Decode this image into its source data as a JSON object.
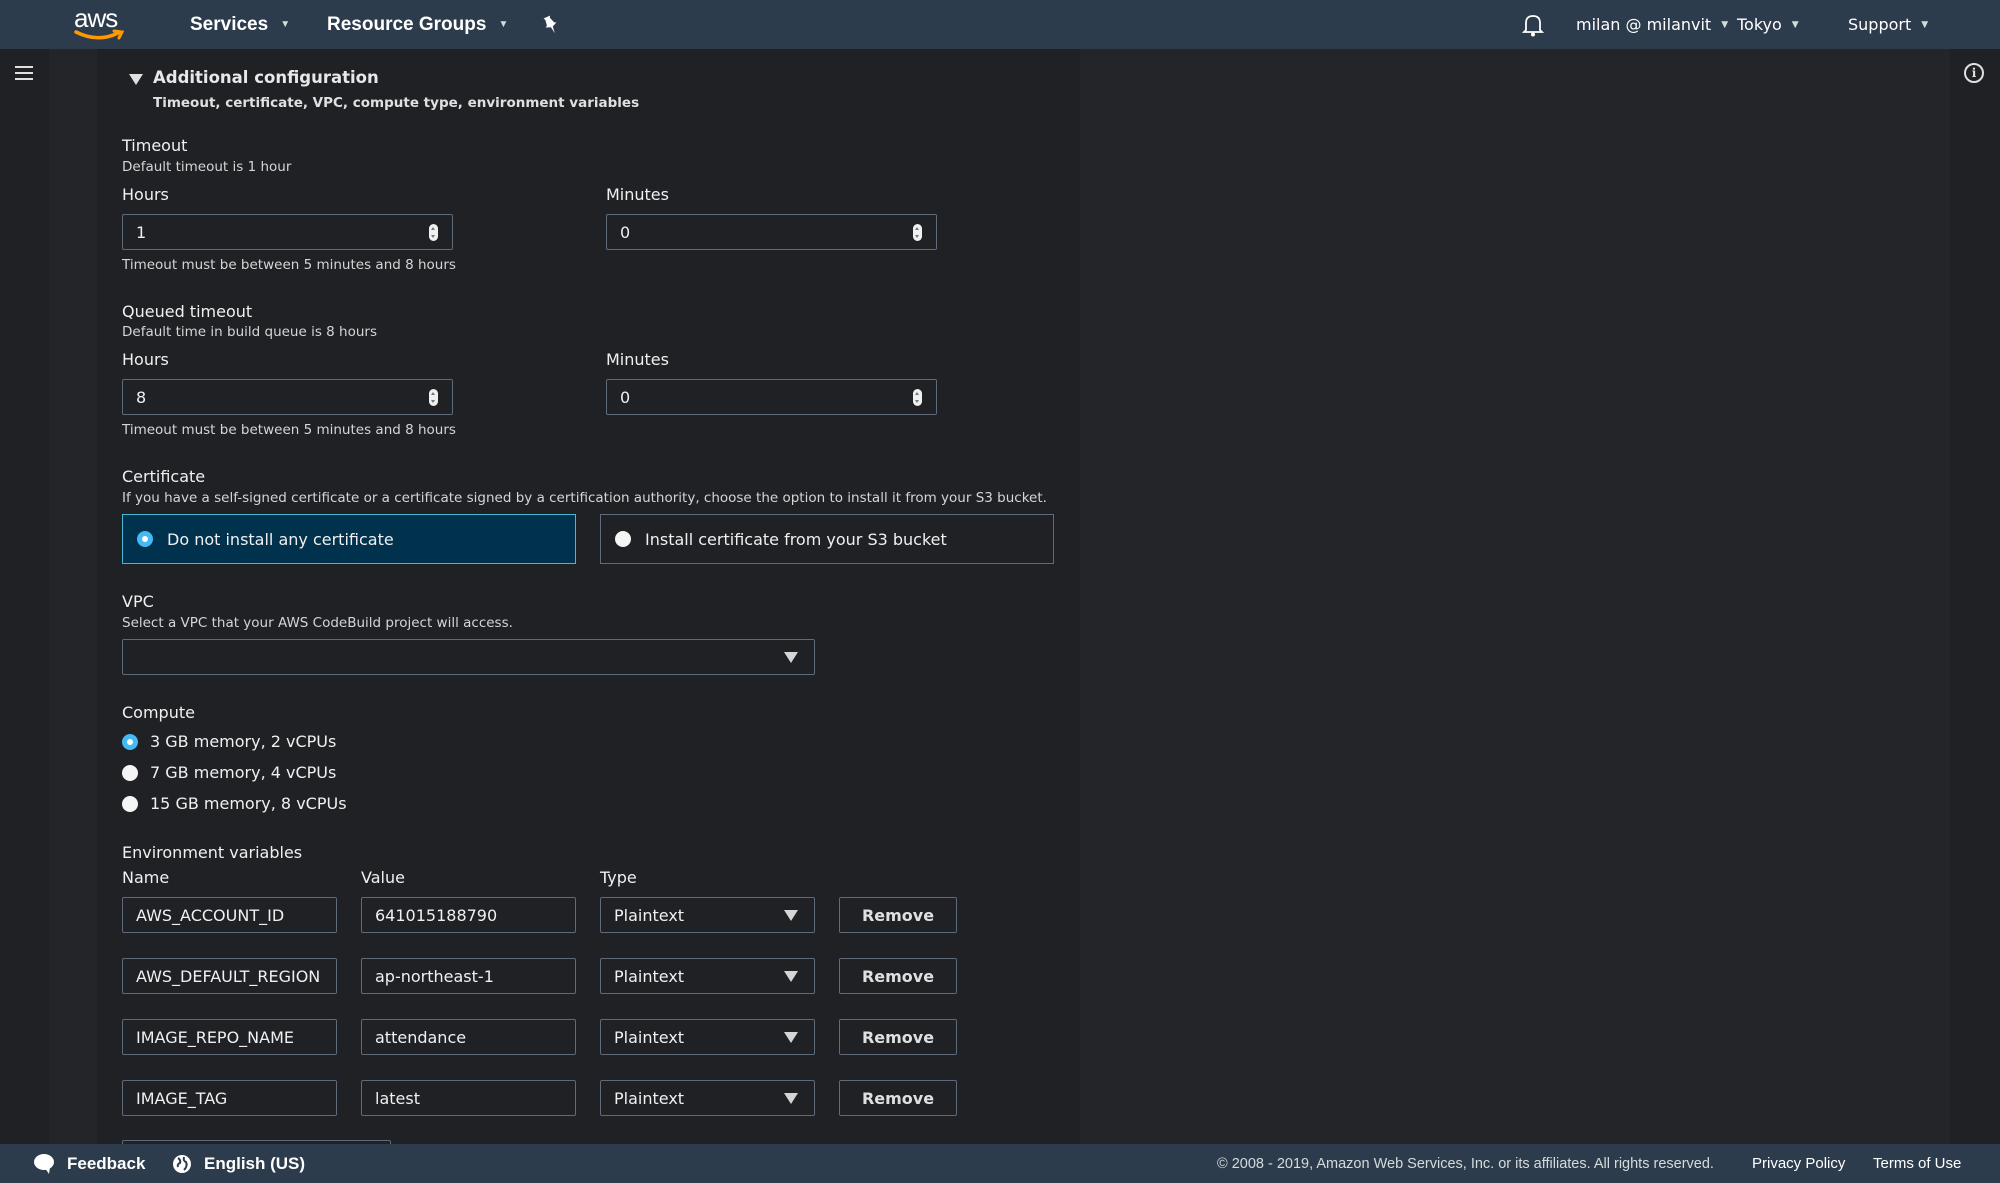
{
  "topnav": {
    "logo": "aws",
    "services": "Services",
    "resource_groups": "Resource Groups",
    "user": "milan @ milanvit",
    "region": "Tokyo",
    "support": "Support"
  },
  "section": {
    "title": "Additional configuration",
    "subtitle": "Timeout, certificate, VPC, compute type, environment variables"
  },
  "timeout": {
    "title": "Timeout",
    "desc": "Default timeout is 1 hour",
    "hours_label": "Hours",
    "hours_value": "1",
    "minutes_label": "Minutes",
    "minutes_value": "0",
    "hint": "Timeout must be between 5 minutes and 8 hours"
  },
  "queued_timeout": {
    "title": "Queued timeout",
    "desc": "Default time in build queue is 8 hours",
    "hours_label": "Hours",
    "hours_value": "8",
    "minutes_label": "Minutes",
    "minutes_value": "0",
    "hint": "Timeout must be between 5 minutes and 8 hours"
  },
  "certificate": {
    "title": "Certificate",
    "desc": "If you have a self-signed certificate or a certificate signed by a certification authority, choose the option to install it from your S3 bucket.",
    "options": [
      {
        "label": "Do not install any certificate",
        "selected": true
      },
      {
        "label": "Install certificate from your S3 bucket",
        "selected": false
      }
    ]
  },
  "vpc": {
    "title": "VPC",
    "desc": "Select a VPC that your AWS CodeBuild project will access.",
    "value": ""
  },
  "compute": {
    "title": "Compute",
    "options": [
      {
        "label": "3 GB memory, 2 vCPUs",
        "selected": true
      },
      {
        "label": "7 GB memory, 4 vCPUs",
        "selected": false
      },
      {
        "label": "15 GB memory, 8 vCPUs",
        "selected": false
      }
    ]
  },
  "env": {
    "title": "Environment variables",
    "col_name": "Name",
    "col_value": "Value",
    "col_type": "Type",
    "remove_label": "Remove",
    "rows": [
      {
        "name": "AWS_ACCOUNT_ID",
        "value": "641015188790",
        "type": "Plaintext"
      },
      {
        "name": "AWS_DEFAULT_REGION",
        "value": "ap-northeast-1",
        "type": "Plaintext"
      },
      {
        "name": "IMAGE_REPO_NAME",
        "value": "attendance",
        "type": "Plaintext"
      },
      {
        "name": "IMAGE_TAG",
        "value": "latest",
        "type": "Plaintext"
      }
    ]
  },
  "footer": {
    "feedback": "Feedback",
    "language": "English (US)",
    "copyright": "© 2008 - 2019, Amazon Web Services, Inc. or its affiliates. All rights reserved.",
    "privacy": "Privacy Policy",
    "terms": "Terms of Use"
  },
  "colors": {
    "nav_bg": "#2d3c4d",
    "page_bg": "#1f2125",
    "selected_tile_bg": "#00324d",
    "selected_tile_border": "#44b9d6",
    "radio_checked": "#44b9f5",
    "aws_orange": "#f90"
  }
}
